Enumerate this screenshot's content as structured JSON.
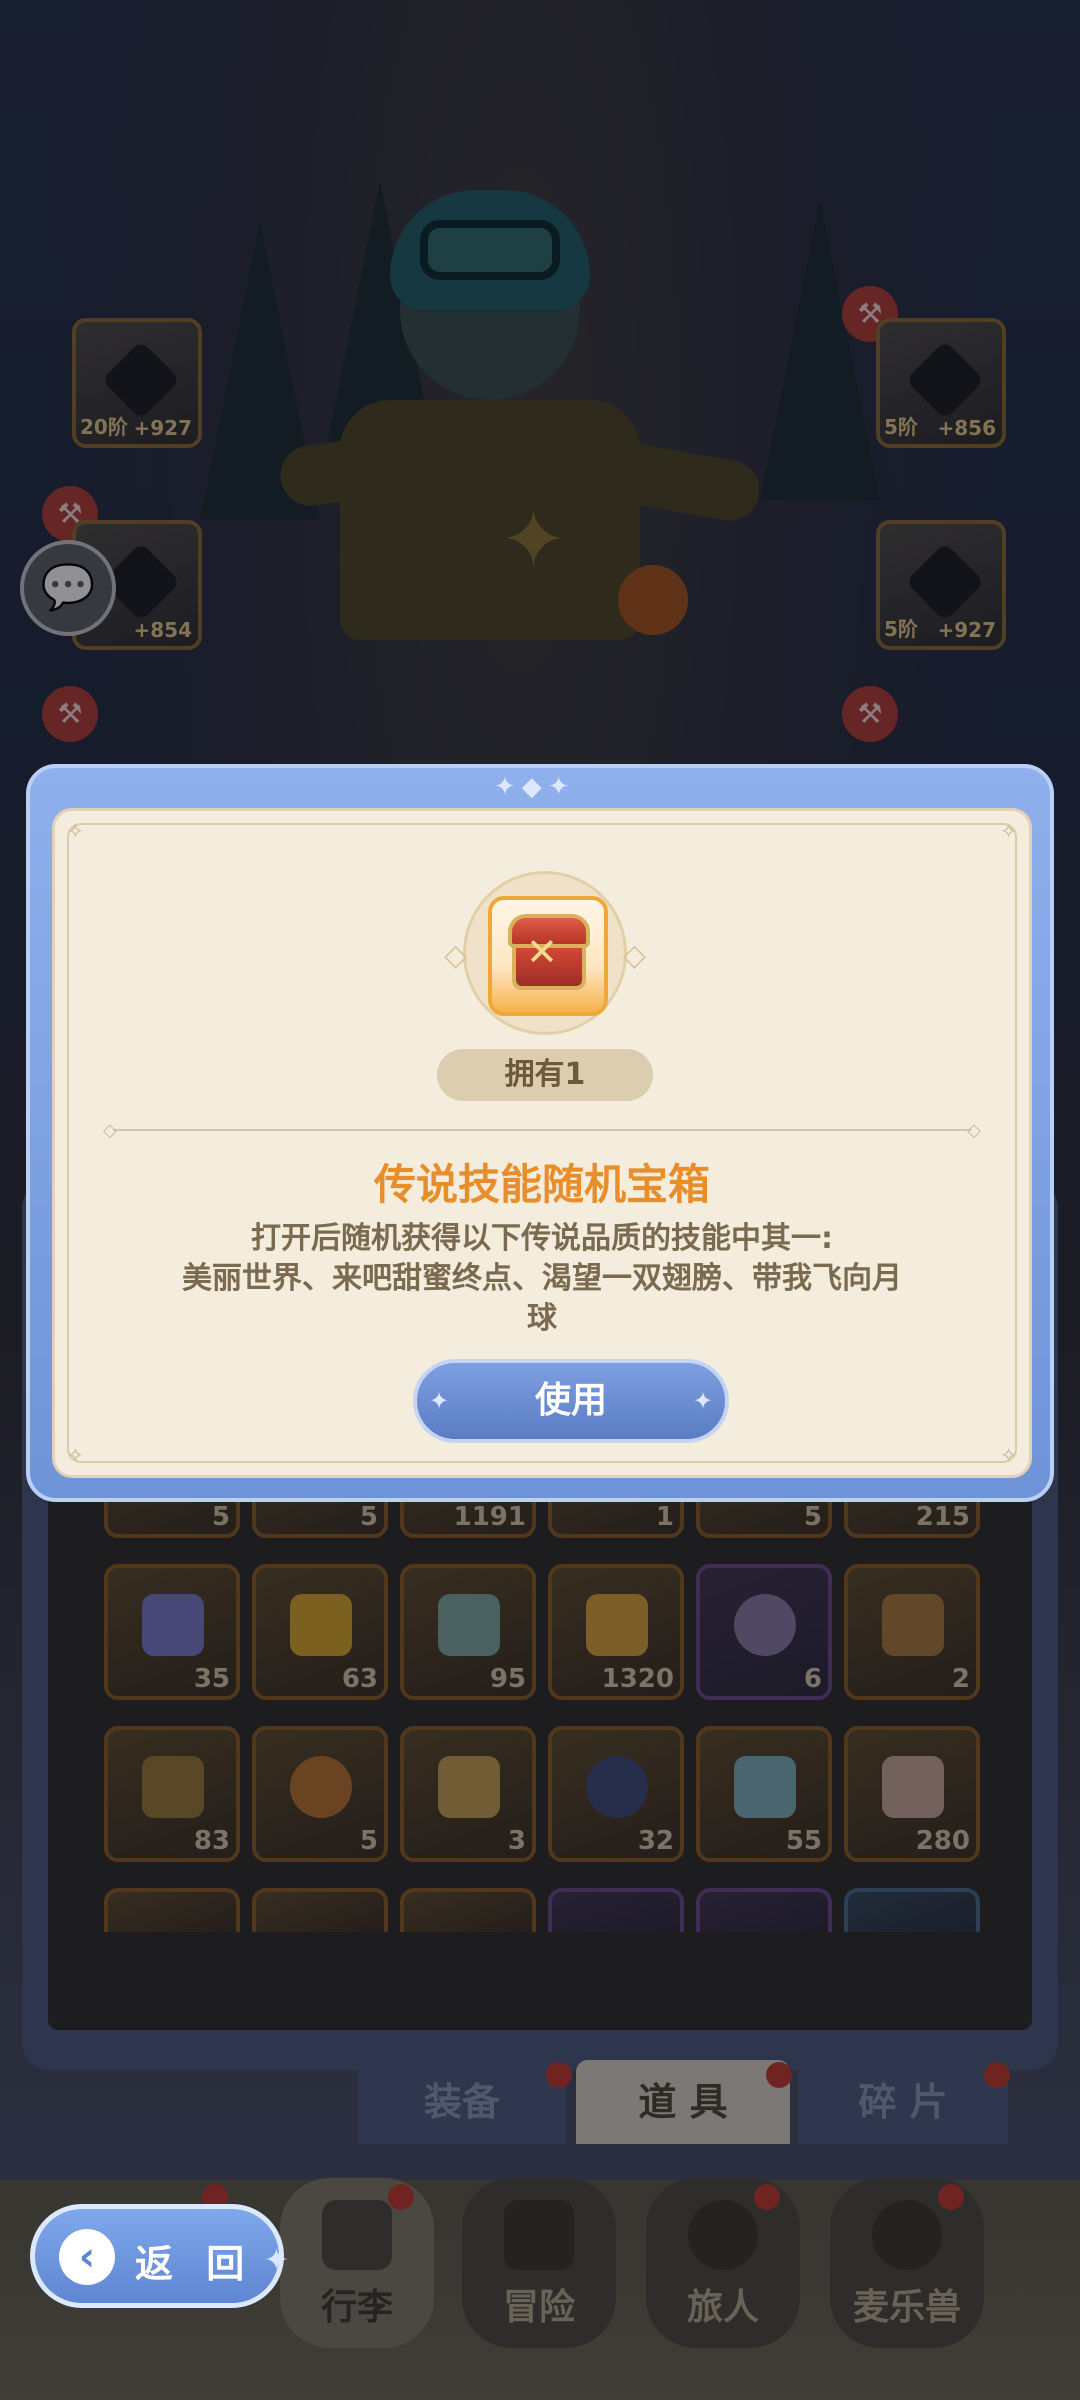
{
  "equipment_slots": [
    {
      "level": "20阶",
      "bonus": "+927"
    },
    {
      "level": "",
      "bonus": "+854"
    },
    {
      "level": "5阶",
      "bonus": "+856"
    },
    {
      "level": "5阶",
      "bonus": "+927"
    }
  ],
  "popup": {
    "owned_label": "拥有1",
    "item_title": "传说技能随机宝箱",
    "description_line1": "打开后随机获得以下传说品质的技能中其一:",
    "description_line2": "美丽世界、来吧甜蜜终点、渴望一双翅膀、带我飞向月",
    "description_line3": "球",
    "use_button_label": "使用"
  },
  "inventory": {
    "row0": [
      "5",
      "5",
      "1191",
      "1",
      "5",
      "215"
    ],
    "row1": [
      "35",
      "63",
      "95",
      "1320",
      "6",
      "2"
    ],
    "row2": [
      "83",
      "5",
      "3",
      "32",
      "55",
      "280"
    ]
  },
  "sub_tabs": {
    "equipment": "装备",
    "items": "道 具",
    "fragments": "碎 片"
  },
  "nav": {
    "back": "返 回",
    "luggage": "行李",
    "adventure": "冒险",
    "travelers": "旅人",
    "pets": "麦乐兽"
  },
  "icons": {
    "chat": "chat-bubble-icon",
    "back": "back-arrow-icon",
    "item": "treasure-chest-icon",
    "hammer": "hammer-icon"
  },
  "colors": {
    "title": "#e78d2a",
    "button": "#5a7cc4",
    "popup_frame": "#8fb0ec",
    "card_bg": "#f4ecdc"
  }
}
